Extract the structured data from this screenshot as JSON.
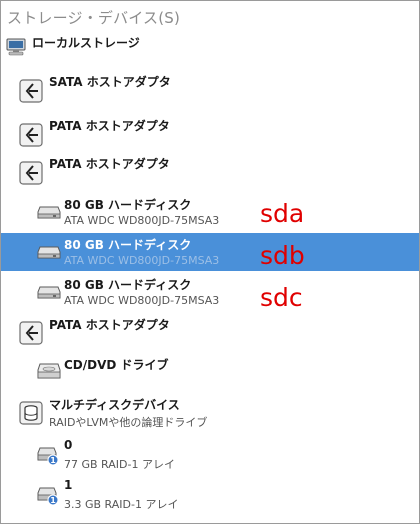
{
  "header": {
    "title": "ストレージ・デバイス(S)"
  },
  "tree": {
    "local_storage": "ローカルストレージ",
    "sata_adapter": "SATA ホストアダプタ",
    "pata_adapter_1": "PATA ホストアダプタ",
    "pata_adapter_2": "PATA ホストアダプタ",
    "disk_a": {
      "label": "80 GB ハードディスク",
      "model": "ATA WDC WD800JD-75MSA3"
    },
    "disk_b": {
      "label": "80 GB ハードディスク",
      "model": "ATA WDC WD800JD-75MSA3"
    },
    "disk_c": {
      "label": "80 GB ハードディスク",
      "model": "ATA WDC WD800JD-75MSA3"
    },
    "pata_adapter_3": "PATA ホストアダプタ",
    "cdrom": "CD/DVD ドライブ",
    "multidisk": {
      "label": "マルチディスクデバイス",
      "sub": "RAIDやLVMや他の論理ドライブ"
    },
    "raid0": {
      "label": "0",
      "sub": "77 GB RAID-1 アレイ"
    },
    "raid1": {
      "label": "1",
      "sub": "3.3 GB RAID-1 アレイ"
    }
  },
  "annotations": {
    "sda": "sda",
    "sdb": "sdb",
    "sdc": "sdc"
  }
}
